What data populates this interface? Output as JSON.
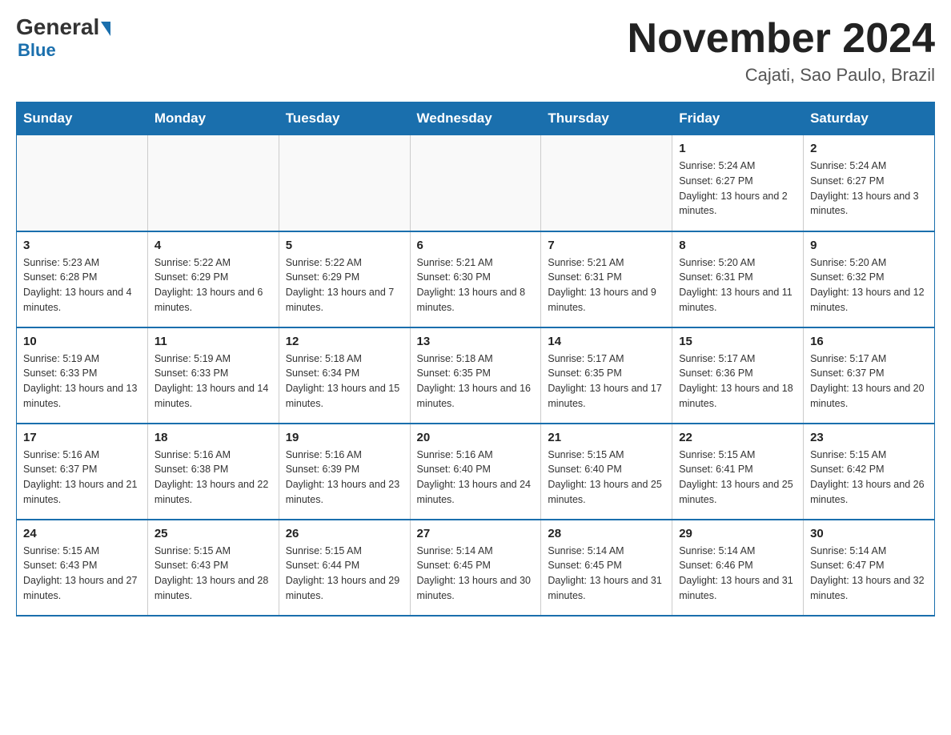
{
  "header": {
    "logo_general": "General",
    "logo_blue": "Blue",
    "month_title": "November 2024",
    "location": "Cajati, Sao Paulo, Brazil"
  },
  "days_of_week": [
    "Sunday",
    "Monday",
    "Tuesday",
    "Wednesday",
    "Thursday",
    "Friday",
    "Saturday"
  ],
  "weeks": [
    [
      {
        "day": "",
        "info": ""
      },
      {
        "day": "",
        "info": ""
      },
      {
        "day": "",
        "info": ""
      },
      {
        "day": "",
        "info": ""
      },
      {
        "day": "",
        "info": ""
      },
      {
        "day": "1",
        "info": "Sunrise: 5:24 AM\nSunset: 6:27 PM\nDaylight: 13 hours and 2 minutes."
      },
      {
        "day": "2",
        "info": "Sunrise: 5:24 AM\nSunset: 6:27 PM\nDaylight: 13 hours and 3 minutes."
      }
    ],
    [
      {
        "day": "3",
        "info": "Sunrise: 5:23 AM\nSunset: 6:28 PM\nDaylight: 13 hours and 4 minutes."
      },
      {
        "day": "4",
        "info": "Sunrise: 5:22 AM\nSunset: 6:29 PM\nDaylight: 13 hours and 6 minutes."
      },
      {
        "day": "5",
        "info": "Sunrise: 5:22 AM\nSunset: 6:29 PM\nDaylight: 13 hours and 7 minutes."
      },
      {
        "day": "6",
        "info": "Sunrise: 5:21 AM\nSunset: 6:30 PM\nDaylight: 13 hours and 8 minutes."
      },
      {
        "day": "7",
        "info": "Sunrise: 5:21 AM\nSunset: 6:31 PM\nDaylight: 13 hours and 9 minutes."
      },
      {
        "day": "8",
        "info": "Sunrise: 5:20 AM\nSunset: 6:31 PM\nDaylight: 13 hours and 11 minutes."
      },
      {
        "day": "9",
        "info": "Sunrise: 5:20 AM\nSunset: 6:32 PM\nDaylight: 13 hours and 12 minutes."
      }
    ],
    [
      {
        "day": "10",
        "info": "Sunrise: 5:19 AM\nSunset: 6:33 PM\nDaylight: 13 hours and 13 minutes."
      },
      {
        "day": "11",
        "info": "Sunrise: 5:19 AM\nSunset: 6:33 PM\nDaylight: 13 hours and 14 minutes."
      },
      {
        "day": "12",
        "info": "Sunrise: 5:18 AM\nSunset: 6:34 PM\nDaylight: 13 hours and 15 minutes."
      },
      {
        "day": "13",
        "info": "Sunrise: 5:18 AM\nSunset: 6:35 PM\nDaylight: 13 hours and 16 minutes."
      },
      {
        "day": "14",
        "info": "Sunrise: 5:17 AM\nSunset: 6:35 PM\nDaylight: 13 hours and 17 minutes."
      },
      {
        "day": "15",
        "info": "Sunrise: 5:17 AM\nSunset: 6:36 PM\nDaylight: 13 hours and 18 minutes."
      },
      {
        "day": "16",
        "info": "Sunrise: 5:17 AM\nSunset: 6:37 PM\nDaylight: 13 hours and 20 minutes."
      }
    ],
    [
      {
        "day": "17",
        "info": "Sunrise: 5:16 AM\nSunset: 6:37 PM\nDaylight: 13 hours and 21 minutes."
      },
      {
        "day": "18",
        "info": "Sunrise: 5:16 AM\nSunset: 6:38 PM\nDaylight: 13 hours and 22 minutes."
      },
      {
        "day": "19",
        "info": "Sunrise: 5:16 AM\nSunset: 6:39 PM\nDaylight: 13 hours and 23 minutes."
      },
      {
        "day": "20",
        "info": "Sunrise: 5:16 AM\nSunset: 6:40 PM\nDaylight: 13 hours and 24 minutes."
      },
      {
        "day": "21",
        "info": "Sunrise: 5:15 AM\nSunset: 6:40 PM\nDaylight: 13 hours and 25 minutes."
      },
      {
        "day": "22",
        "info": "Sunrise: 5:15 AM\nSunset: 6:41 PM\nDaylight: 13 hours and 25 minutes."
      },
      {
        "day": "23",
        "info": "Sunrise: 5:15 AM\nSunset: 6:42 PM\nDaylight: 13 hours and 26 minutes."
      }
    ],
    [
      {
        "day": "24",
        "info": "Sunrise: 5:15 AM\nSunset: 6:43 PM\nDaylight: 13 hours and 27 minutes."
      },
      {
        "day": "25",
        "info": "Sunrise: 5:15 AM\nSunset: 6:43 PM\nDaylight: 13 hours and 28 minutes."
      },
      {
        "day": "26",
        "info": "Sunrise: 5:15 AM\nSunset: 6:44 PM\nDaylight: 13 hours and 29 minutes."
      },
      {
        "day": "27",
        "info": "Sunrise: 5:14 AM\nSunset: 6:45 PM\nDaylight: 13 hours and 30 minutes."
      },
      {
        "day": "28",
        "info": "Sunrise: 5:14 AM\nSunset: 6:45 PM\nDaylight: 13 hours and 31 minutes."
      },
      {
        "day": "29",
        "info": "Sunrise: 5:14 AM\nSunset: 6:46 PM\nDaylight: 13 hours and 31 minutes."
      },
      {
        "day": "30",
        "info": "Sunrise: 5:14 AM\nSunset: 6:47 PM\nDaylight: 13 hours and 32 minutes."
      }
    ]
  ]
}
